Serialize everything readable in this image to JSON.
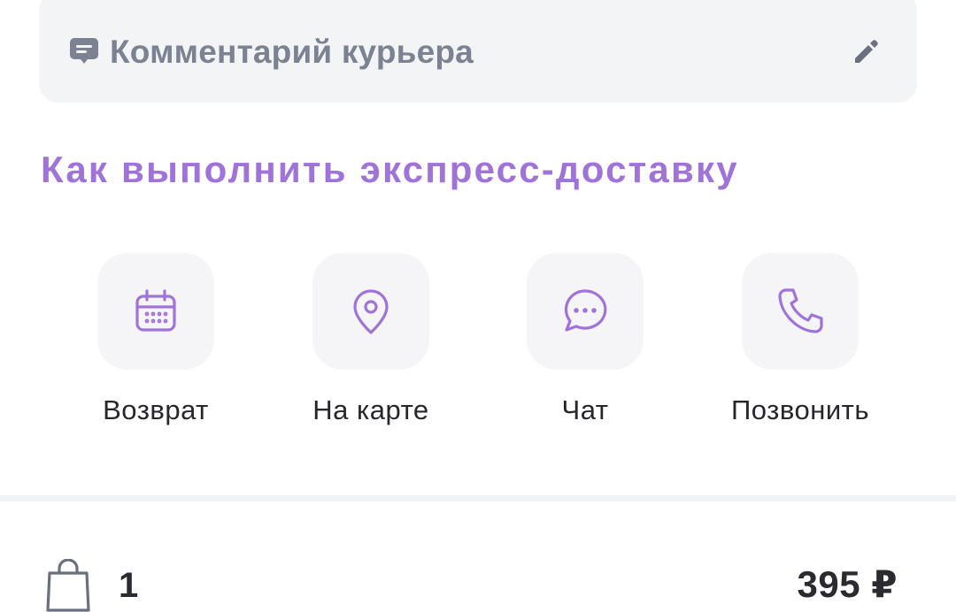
{
  "comment": {
    "placeholder": "Комментарий курьера",
    "icon": "comment-icon",
    "edit_icon": "pencil-icon"
  },
  "express_link": "Как выполнить экспресс-доставку",
  "actions": [
    {
      "label": "Возврат",
      "icon": "calendar-icon"
    },
    {
      "label": "На карте",
      "icon": "map-pin-icon"
    },
    {
      "label": "Чат",
      "icon": "chat-icon"
    },
    {
      "label": "Позвонить",
      "icon": "phone-icon"
    }
  ],
  "order": {
    "icon": "shopping-bag-icon",
    "count": "1",
    "price": "395 ₽"
  },
  "colors": {
    "accent": "#a073d9",
    "muted_text": "#7c8291",
    "tile_bg": "#f5f5f7",
    "box_bg": "#f3f4f6"
  }
}
